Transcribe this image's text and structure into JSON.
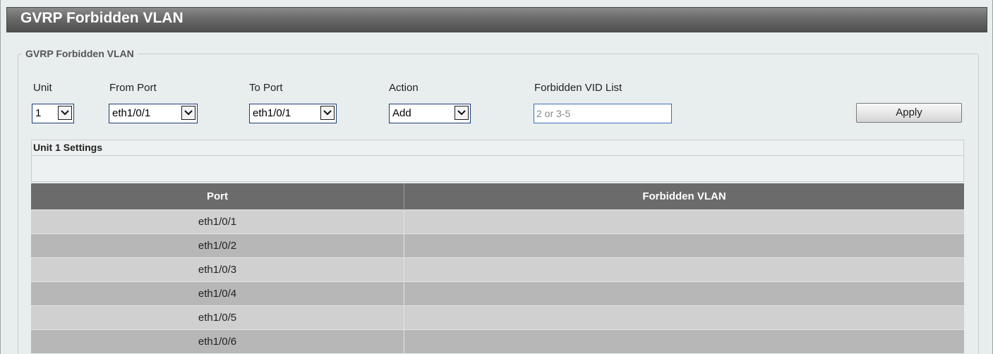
{
  "page": {
    "title": "GVRP Forbidden VLAN"
  },
  "form": {
    "legend": "GVRP Forbidden VLAN",
    "unit_label": "Unit",
    "unit_value": "1",
    "from_port_label": "From Port",
    "from_port_value": "eth1/0/1",
    "to_port_label": "To Port",
    "to_port_value": "eth1/0/1",
    "action_label": "Action",
    "action_value": "Add",
    "vid_list_label": "Forbidden VID List",
    "vid_list_placeholder": "2 or 3-5",
    "apply_label": "Apply"
  },
  "settings": {
    "header": "Unit 1 Settings"
  },
  "table": {
    "columns": [
      "Port",
      "Forbidden VLAN"
    ],
    "rows": [
      {
        "port": "eth1/0/1",
        "forbidden_vlan": ""
      },
      {
        "port": "eth1/0/2",
        "forbidden_vlan": ""
      },
      {
        "port": "eth1/0/3",
        "forbidden_vlan": ""
      },
      {
        "port": "eth1/0/4",
        "forbidden_vlan": ""
      },
      {
        "port": "eth1/0/5",
        "forbidden_vlan": ""
      },
      {
        "port": "eth1/0/6",
        "forbidden_vlan": ""
      }
    ]
  },
  "colors": {
    "title_bar": "#6a6a6a",
    "table_header": "#6b6b6b",
    "row_light": "#d0d0d0",
    "row_dark": "#b7b7b7",
    "background": "#e8eded"
  },
  "icons": {
    "dropdown": "chevron-down-icon"
  }
}
